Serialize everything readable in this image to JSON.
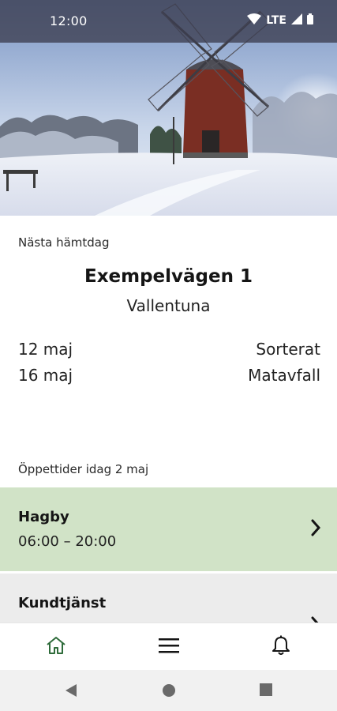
{
  "status_bar": {
    "time": "12:00",
    "network": "LTE"
  },
  "next_pickup": {
    "label": "Nästa hämtdag",
    "address": "Exempelvägen 1",
    "city": "Vallentuna",
    "rows": [
      {
        "date": "12 maj",
        "type": "Sorterat"
      },
      {
        "date": "16 maj",
        "type": "Matavfall"
      }
    ]
  },
  "opening_hours": {
    "label": "Öppettider idag 2 maj",
    "stations": [
      {
        "name": "Hagby",
        "hours": "06:00 – 20:00"
      },
      {
        "name": "Kundtjänst",
        "hours": ""
      }
    ]
  },
  "bottom_nav": {
    "items": [
      "home-icon",
      "menu-icon",
      "bell-icon"
    ]
  },
  "colors": {
    "accent": "#2e6b3a",
    "station_bg": "#d1e3c7",
    "support_bg": "#ececec"
  }
}
